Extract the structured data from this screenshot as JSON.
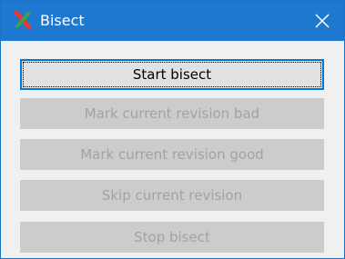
{
  "window": {
    "title": "Bisect",
    "app_icon": "bisect-icon",
    "close_icon": "close-icon"
  },
  "buttons": {
    "start_bisect": "Start bisect",
    "mark_bad": "Mark current revision bad",
    "mark_good": "Mark current revision good",
    "skip": "Skip current revision",
    "stop": "Stop bisect"
  },
  "states": {
    "start_bisect": "enabled-focused",
    "mark_bad": "disabled",
    "mark_good": "disabled",
    "skip": "disabled",
    "stop": "disabled"
  },
  "colors": {
    "titlebar": "#1e78d0",
    "focus_border": "#0078d7",
    "disabled_button": "#cccccc",
    "disabled_text": "#a2a2a2",
    "dialog_background": "#f0f0f0"
  }
}
